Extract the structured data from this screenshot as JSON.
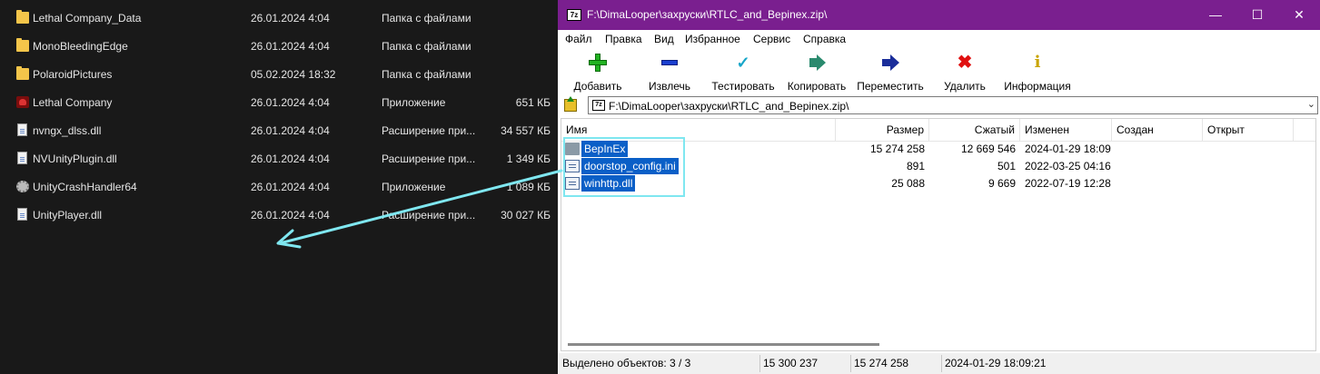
{
  "explorer": {
    "rows": [
      {
        "name": "Lethal Company_Data",
        "date": "26.01.2024 4:04",
        "type": "Папка с файлами",
        "size": "",
        "icon": "folder-icon"
      },
      {
        "name": "MonoBleedingEdge",
        "date": "26.01.2024 4:04",
        "type": "Папка с файлами",
        "size": "",
        "icon": "folder-icon"
      },
      {
        "name": "PolaroidPictures",
        "date": "05.02.2024 18:32",
        "type": "Папка с файлами",
        "size": "",
        "icon": "folder-icon"
      },
      {
        "name": "Lethal Company",
        "date": "26.01.2024 4:04",
        "type": "Приложение",
        "size": "651 КБ",
        "icon": "app-icon"
      },
      {
        "name": "nvngx_dlss.dll",
        "date": "26.01.2024 4:04",
        "type": "Расширение при...",
        "size": "34 557 КБ",
        "icon": "file-icon"
      },
      {
        "name": "NVUnityPlugin.dll",
        "date": "26.01.2024 4:04",
        "type": "Расширение при...",
        "size": "1 349 КБ",
        "icon": "file-icon"
      },
      {
        "name": "UnityCrashHandler64",
        "date": "26.01.2024 4:04",
        "type": "Приложение",
        "size": "1 089 КБ",
        "icon": "gear-icon"
      },
      {
        "name": "UnityPlayer.dll",
        "date": "26.01.2024 4:04",
        "type": "Расширение при...",
        "size": "30 027 КБ",
        "icon": "file-icon"
      }
    ]
  },
  "zip": {
    "logo": "7z",
    "title": "F:\\DimaLooper\\захруски\\RTLC_and_Bepinex.zip\\",
    "window_controls": {
      "minimize": "—",
      "maximize": "☐",
      "close": "✕"
    },
    "menu": [
      "Файл",
      "Правка",
      "Вид",
      "Избранное",
      "Сервис",
      "Справка"
    ],
    "toolbar": {
      "add": "Добавить",
      "extract": "Извлечь",
      "test": "Тестировать",
      "copy": "Копировать",
      "move": "Переместить",
      "delete": "Удалить",
      "info": "Информация"
    },
    "address": "F:\\DimaLooper\\захруски\\RTLC_and_Bepinex.zip\\",
    "columns": {
      "name": "Имя",
      "size": "Размер",
      "packed": "Сжатый",
      "modified": "Изменен",
      "created": "Создан",
      "accessed": "Открыт"
    },
    "files": [
      {
        "name": "BepInEx",
        "size": "15 274 258",
        "packed": "12 669 546",
        "modified": "2024-01-29 18:09",
        "icon": "folder-icon"
      },
      {
        "name": "doorstop_config.ini",
        "size": "891",
        "packed": "501",
        "modified": "2022-03-25 04:16",
        "icon": "doc-icon"
      },
      {
        "name": "winhttp.dll",
        "size": "25 088",
        "packed": "9 669",
        "modified": "2022-07-19 12:28",
        "icon": "doc-icon"
      }
    ],
    "status": {
      "selected": "Выделено объектов: 3 / 3",
      "total_size": "15 300 237",
      "total_packed": "15 274 258",
      "date": "2024-01-29 18:09:21"
    }
  },
  "colors": {
    "titlebar": "#7a1f8f",
    "selection": "#0a5fc7",
    "annotation_arrow": "#7fe7f0"
  }
}
